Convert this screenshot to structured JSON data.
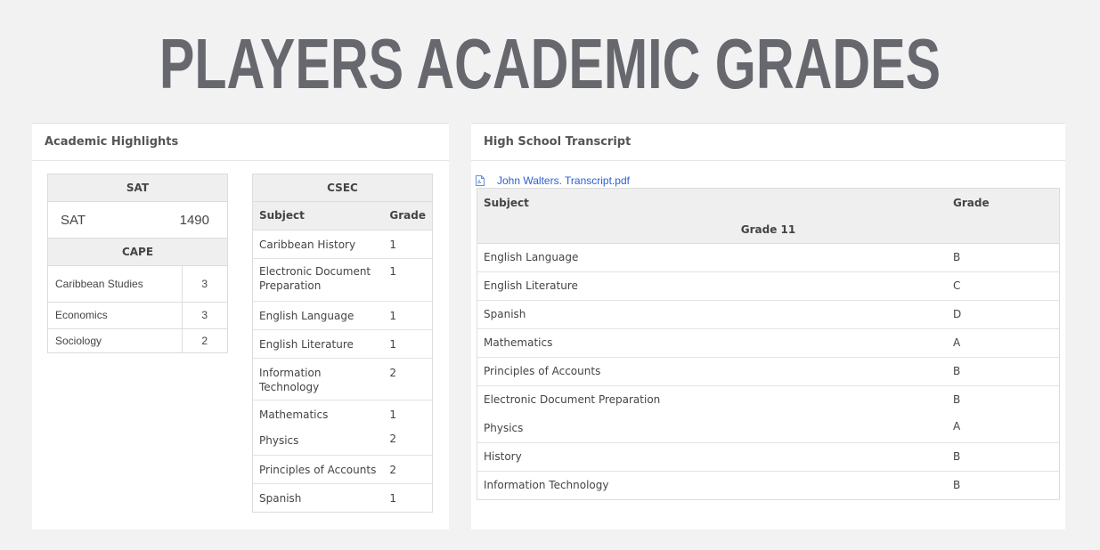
{
  "page": {
    "title": "PLAYERS ACADEMIC GRADES"
  },
  "highlights": {
    "header": "Academic Highlights",
    "sat": {
      "heading": "SAT",
      "label": "SAT",
      "score": "1490"
    },
    "cape": {
      "heading": "CAPE",
      "rows": [
        {
          "subject": "Caribbean Studies",
          "grade": "3"
        },
        {
          "subject": "Economics",
          "grade": "3"
        },
        {
          "subject": "Sociology",
          "grade": "2"
        }
      ]
    },
    "csec": {
      "heading": "CSEC",
      "subject_col": "Subject",
      "grade_col": "Grade",
      "rows": [
        {
          "subject": "Caribbean History",
          "grade": "1"
        },
        {
          "subject": "Electronic Document Preparation",
          "grade": "1"
        },
        {
          "subject": "English Language",
          "grade": "1"
        },
        {
          "subject": "English Literature",
          "grade": "1"
        },
        {
          "subject": "Information Technology",
          "grade": "2"
        },
        {
          "subject": "Mathematics",
          "grade": "1"
        },
        {
          "subject": "Physics",
          "grade": "2"
        },
        {
          "subject": "Principles of Accounts",
          "grade": "2"
        },
        {
          "subject": "Spanish",
          "grade": "1"
        }
      ]
    }
  },
  "transcript": {
    "header": "High School Transcript",
    "file_icon": "pdf-file-icon",
    "file_name": "John Walters. Transcript.pdf",
    "subject_col": "Subject",
    "grade_col": "Grade",
    "group_label": "Grade 11",
    "rows": [
      {
        "subject": "English Language",
        "grade": "B"
      },
      {
        "subject": "English Literature",
        "grade": "C"
      },
      {
        "subject": "Spanish",
        "grade": "D"
      },
      {
        "subject": "Mathematics",
        "grade": "A"
      },
      {
        "subject": "Principles of Accounts",
        "grade": "B"
      },
      {
        "subject": "Electronic Document Preparation",
        "grade": "B"
      },
      {
        "subject": "Physics",
        "grade": "A"
      },
      {
        "subject": "History",
        "grade": "B"
      },
      {
        "subject": "Information Technology",
        "grade": "B"
      }
    ]
  },
  "colors": {
    "title": "#67686e",
    "link": "#2a5fd6",
    "background": "#f2f2f3"
  }
}
